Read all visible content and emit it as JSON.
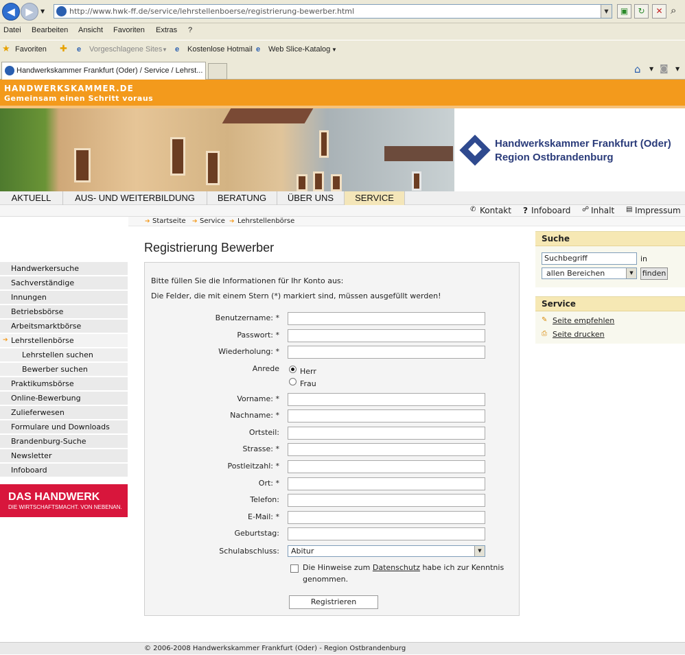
{
  "browser": {
    "url": "http://www.hwk-ff.de/service/lehrstellenboerse/registrierung-bewerber.html",
    "menu": [
      "Datei",
      "Bearbeiten",
      "Ansicht",
      "Favoriten",
      "Extras",
      "?"
    ],
    "favorites_label": "Favoriten",
    "fav_links": [
      "Vorgeschlagene Sites",
      "Kostenlose Hotmail",
      "Web Slice-Katalog"
    ],
    "tab_title": "Handwerkskammer Frankfurt (Oder) / Service / Lehrst..."
  },
  "site": {
    "top_brand": "HANDWERKSKAMMER.DE",
    "slogan": "Gemeinsam einen Schritt voraus",
    "logo_line1": "Handwerkskammer Frankfurt (Oder)",
    "logo_line2": "Region Ostbrandenburg",
    "main_nav": [
      "AKTUELL",
      "AUS- UND WEITERBILDUNG",
      "BERATUNG",
      "ÜBER UNS",
      "SERVICE"
    ],
    "sub_nav": [
      "Kontakt",
      "Infoboard",
      "Inhalt",
      "Impressum"
    ],
    "breadcrumb": [
      "Startseite",
      "Service",
      "Lehrstellenbörse"
    ],
    "left_nav": [
      "Handwerkersuche",
      "Sachverständige",
      "Innungen",
      "Betriebsbörse",
      "Arbeitsmarktbörse",
      "Lehrstellenbörse",
      "Lehrstellen suchen",
      "Bewerber suchen",
      "Praktikumsbörse",
      "Online-Bewerbung",
      "Zulieferwesen",
      "Formulare und Downloads",
      "Brandenburg-Suche",
      "Newsletter",
      "Infoboard"
    ],
    "banner_line1": "DAS HANDWERK",
    "banner_line2": "DIE WIRTSCHAFTSMACHT. VON NEBENAN."
  },
  "form": {
    "title": "Registrierung Bewerber",
    "intro1": "Bitte füllen Sie die Informationen für Ihr Konto aus:",
    "intro2": "Die Felder, die mit einem Stern (*) markiert sind, müssen ausgefüllt werden!",
    "labels": [
      "Benutzername: *",
      "Passwort: *",
      "Wiederholung: *",
      "Anrede",
      "Vorname: *",
      "Nachname: *",
      "Ortsteil:",
      "Strasse: *",
      "Postleitzahl: *",
      "Ort: *",
      "Telefon:",
      "E-Mail: *",
      "Geburtstag:",
      "Schulabschluss:"
    ],
    "anrede_options": [
      "Herr",
      "Frau"
    ],
    "schulabschluss_value": "Abitur",
    "consent_pre": "Die Hinweise zum ",
    "consent_link": "Datenschutz",
    "consent_post": " habe ich zur Kenntnis genommen.",
    "submit": "Registrieren"
  },
  "sidebar": {
    "search_title": "Suche",
    "search_placeholder": "Suchbegriff",
    "in_label": "in",
    "scope_value": "allen Bereichen",
    "find_button": "finden",
    "service_title": "Service",
    "service_links": [
      "Seite empfehlen",
      "Seite drucken"
    ]
  },
  "footer": "© 2006-2008 Handwerkskammer Frankfurt (Oder) - Region Ostbrandenburg"
}
